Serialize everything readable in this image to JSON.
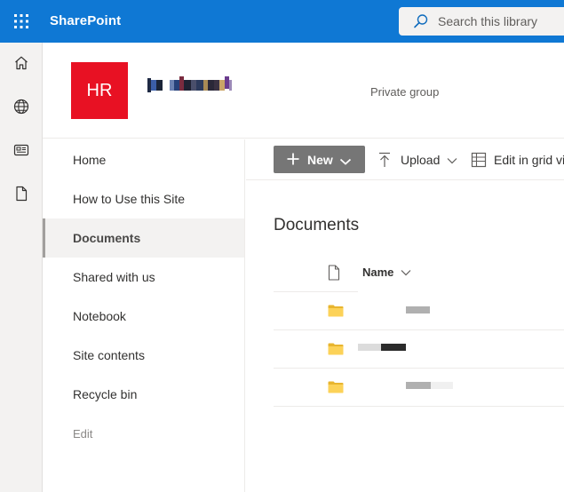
{
  "suitebar": {
    "app_name": "SharePoint",
    "search_placeholder": "Search this library",
    "color": "#0f78d4"
  },
  "appbar": {
    "items": [
      {
        "icon": "home-icon"
      },
      {
        "icon": "globe-icon"
      },
      {
        "icon": "news-icon"
      },
      {
        "icon": "document-icon"
      }
    ]
  },
  "site": {
    "logo_text": "HR",
    "logo_color": "#e81123",
    "privacy": "Private group"
  },
  "leftnav": {
    "items": [
      {
        "label": "Home"
      },
      {
        "label": "How to Use this Site"
      },
      {
        "label": "Documents",
        "selected": true
      },
      {
        "label": "Shared with us"
      },
      {
        "label": "Notebook"
      },
      {
        "label": "Site contents"
      },
      {
        "label": "Recycle bin"
      },
      {
        "label": "Edit"
      }
    ]
  },
  "commandbar": {
    "new_label": "New",
    "upload_label": "Upload",
    "grid_label": "Edit in grid view"
  },
  "library": {
    "title": "Documents",
    "name_column": "Name",
    "rows": [
      {
        "type": "folder"
      },
      {
        "type": "folder"
      },
      {
        "type": "folder"
      }
    ]
  }
}
